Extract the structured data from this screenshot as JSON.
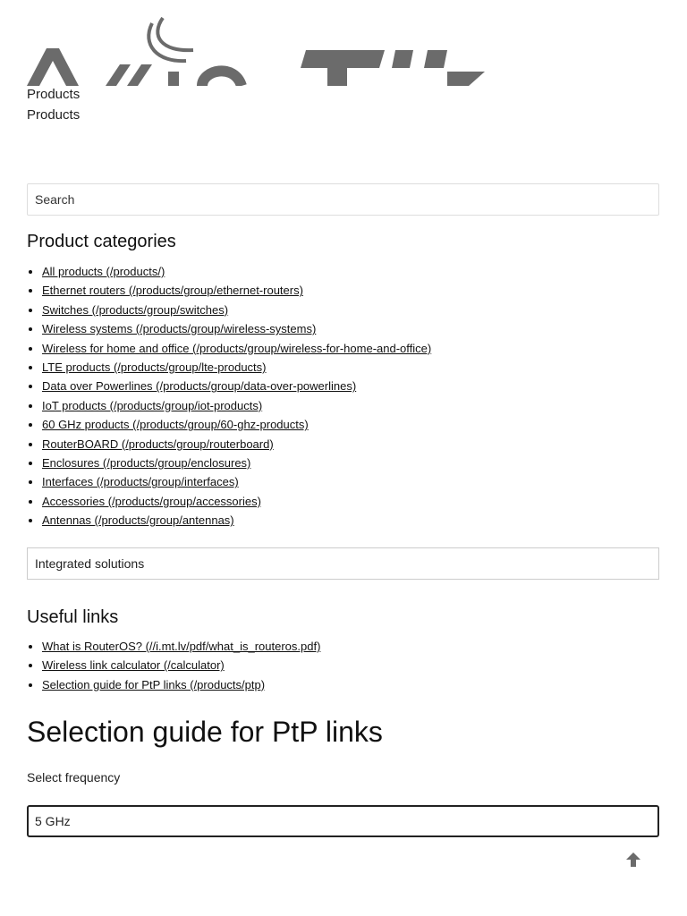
{
  "header": {
    "logo_name": "mikrotik-logo",
    "products_label_1": "Products",
    "products_label_2": "Products"
  },
  "search": {
    "placeholder": "Search"
  },
  "categories": {
    "title": "Product categories",
    "items": [
      {
        "label": "All products (/products/)"
      },
      {
        "label": "Ethernet routers (/products/group/ethernet-routers)"
      },
      {
        "label": "Switches (/products/group/switches)"
      },
      {
        "label": "Wireless systems (/products/group/wireless-systems)"
      },
      {
        "label": "Wireless for home and office (/products/group/wireless-for-home-and-office)"
      },
      {
        "label": "LTE products (/products/group/lte-products)"
      },
      {
        "label": "Data over Powerlines (/products/group/data-over-powerlines)"
      },
      {
        "label": "IoT products (/products/group/iot-products)"
      },
      {
        "label": "60 GHz products (/products/group/60-ghz-products)"
      },
      {
        "label": "RouterBOARD (/products/group/routerboard)"
      },
      {
        "label": "Enclosures (/products/group/enclosures)"
      },
      {
        "label": "Interfaces (/products/group/interfaces)"
      },
      {
        "label": "Accessories (/products/group/accessories)"
      },
      {
        "label": "Antennas (/products/group/antennas)"
      }
    ]
  },
  "integrated": {
    "label": "Integrated solutions"
  },
  "useful": {
    "title": "Useful links",
    "items": [
      {
        "label": "What is RouterOS? (//i.mt.lv/pdf/what_is_routeros.pdf)"
      },
      {
        "label": "Wireless link calculator (/calculator)"
      },
      {
        "label": "Selection guide for PtP links (/products/ptp)"
      }
    ]
  },
  "main": {
    "title": "Selection guide for PtP links",
    "frequency_label": "Select frequency",
    "frequency_value": "5 GHz"
  },
  "icons": {
    "to_top": "arrow-up-icon"
  },
  "colors": {
    "logo_gray": "#6b6b6b",
    "text": "#111111",
    "border": "#dddddd"
  }
}
